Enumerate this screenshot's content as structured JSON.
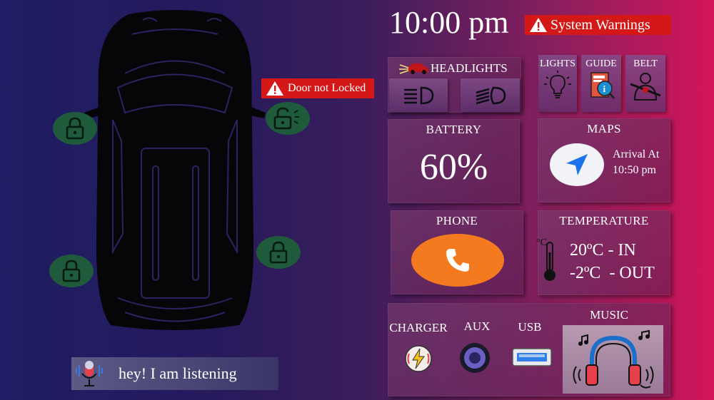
{
  "clock": {
    "time": "10:00 pm"
  },
  "system_warnings": {
    "label": "System Warnings"
  },
  "door_warning": {
    "label": "Door not Locked"
  },
  "headlights": {
    "title": "HEADLIGHTS"
  },
  "quick_buttons": {
    "lights": "LIGHTS",
    "guide": "GUIDE",
    "belt": "BELT"
  },
  "battery": {
    "title": "BATTERY",
    "value": "60%"
  },
  "maps": {
    "title": "MAPS",
    "arrival_label": "Arrival At",
    "arrival_time": "10:50 pm"
  },
  "phone": {
    "title": "PHONE"
  },
  "temperature": {
    "title": "TEMPERATURE",
    "inside": "20ºC - IN",
    "outside": "-2ºC  - OUT"
  },
  "connectivity": {
    "charger": "CHARGER",
    "aux": "AUX",
    "usb": "USB"
  },
  "music": {
    "title": "MUSIC"
  },
  "voice": {
    "status": "hey! I am listening"
  },
  "colors": {
    "warning_red": "#d41818",
    "lock_green": "#1f5a3a",
    "phone_orange": "#f47a1f",
    "nav_blue": "#1a73e8"
  }
}
